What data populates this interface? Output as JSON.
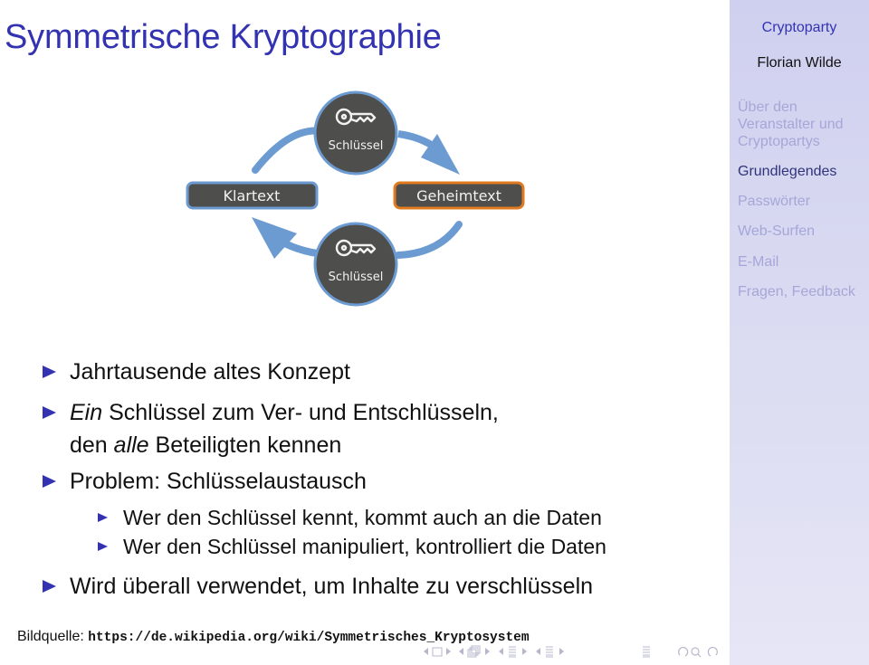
{
  "slide": {
    "title": "Symmetrische Kryptographie"
  },
  "sidebar": {
    "title": "Cryptoparty",
    "author": "Florian Wilde",
    "items": [
      {
        "label_lines": [
          "Über den",
          "Veranstalter und",
          "Cryptopartys"
        ],
        "active": false
      },
      {
        "label": "Grundlegendes",
        "active": true
      },
      {
        "label": "Passwörter",
        "active": false
      },
      {
        "label": "Web-Surfen",
        "active": false
      },
      {
        "label": "E-Mail",
        "active": false
      },
      {
        "label": "Fragen, Feedback",
        "active": false
      }
    ]
  },
  "diagram": {
    "plaintext_label": "Klartext",
    "ciphertext_label": "Geheimtext",
    "top_key_label": "Schlüssel",
    "bottom_key_label": "Schlüssel",
    "colors": {
      "box_fill": "#4e4e4c",
      "arrow": "#6c9bd2",
      "plaintext_border": "#6c9bd2",
      "ciphertext_border": "#e07b1f"
    }
  },
  "bullets": [
    {
      "level": 1,
      "parts": [
        {
          "text": "Jahrtausende altes Konzept"
        }
      ]
    },
    {
      "level": 1,
      "parts": [
        {
          "text": "Ein",
          "italic": true
        },
        {
          "text": " Schlüssel zum Ver- und Entschlüsseln,"
        }
      ]
    },
    {
      "level": 1,
      "continuation": true,
      "parts": [
        {
          "text": "den "
        },
        {
          "text": "alle",
          "italic": true
        },
        {
          "text": " Beteiligten kennen"
        }
      ]
    },
    {
      "level": 1,
      "parts": [
        {
          "text": "Problem: Schlüsselaustausch"
        }
      ]
    },
    {
      "level": 2,
      "parts": [
        {
          "text": "Wer den Schlüssel kennt, kommt auch an die Daten"
        }
      ]
    },
    {
      "level": 2,
      "parts": [
        {
          "text": "Wer den Schlüssel manipuliert, kontrolliert die Daten"
        }
      ]
    },
    {
      "level": 1,
      "parts": [
        {
          "text": "Wird überall verwendet, um Inhalte zu verschlüsseln"
        }
      ]
    }
  ],
  "source": {
    "label": "Bildquelle:",
    "url": "https://de.wikipedia.org/wiki/Symmetrisches_Kryptosystem"
  },
  "navigation": {
    "icons": [
      "nav-frame-prev",
      "nav-frame",
      "nav-frame-next",
      "nav-slide-prev",
      "nav-slide",
      "nav-slide-next",
      "nav-subsection-prev",
      "nav-subsection",
      "nav-subsection-next",
      "nav-section-prev",
      "nav-section",
      "nav-section-next",
      "nav-toc",
      "nav-back",
      "nav-search",
      "nav-forward"
    ]
  },
  "colors": {
    "accent": "#3333b2",
    "sidebar_active": "#33337a",
    "sidebar_inactive": "#a6a6d8"
  }
}
